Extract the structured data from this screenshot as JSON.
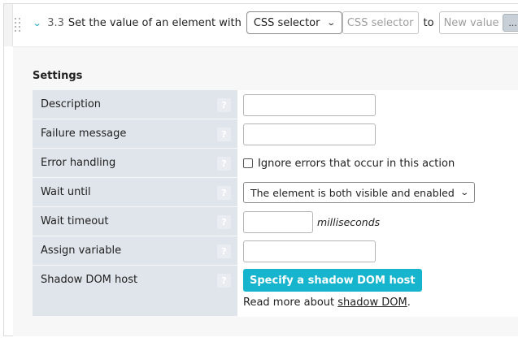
{
  "step": {
    "number": "3.3",
    "title": "Set the value of an element with",
    "selector_type": "CSS selector",
    "selector_placeholder": "CSS selector",
    "to_label": "to",
    "value_placeholder": "New value",
    "more_button": "..."
  },
  "settings": {
    "heading": "Settings",
    "help_glyph": "?",
    "rows": [
      {
        "label": "Description"
      },
      {
        "label": "Failure message"
      },
      {
        "label": "Error handling",
        "checkbox_label": "Ignore errors that occur in this action"
      },
      {
        "label": "Wait until",
        "selected": "The element is both visible and enabled"
      },
      {
        "label": "Wait timeout",
        "unit": "milliseconds"
      },
      {
        "label": "Assign variable"
      },
      {
        "label": "Shadow DOM host",
        "button": "Specify a shadow DOM host",
        "read_more_prefix": "Read more about",
        "read_more_link": "shadow DOM",
        "read_more_suffix": "."
      }
    ]
  },
  "icons": {
    "collapse": "chevron-down-icon",
    "drag": "drag-handle-icon",
    "help": "help-icon"
  },
  "colors": {
    "accent": "#17b4ce",
    "label_bg": "#dfe5eb",
    "panel_bg": "#f7f7f7"
  }
}
